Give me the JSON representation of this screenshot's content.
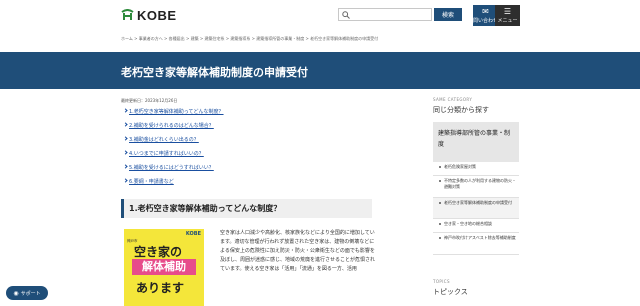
{
  "header": {
    "logo_text": "KOBE",
    "search_button": "検索",
    "contact_label": "問い合わせ",
    "menu_label": "メニュー"
  },
  "breadcrumb": "ホーム > 事業者の方へ > 各種届出 > 建築 > 建築住宅系 > 建築指導系 > 建築指導所管の事業・制度 > 老朽空き家等解体補助制度の申請受付",
  "page": {
    "title": "老朽空き家等解体補助制度の申請受付",
    "updated": "最終更新日：2023年12月26日"
  },
  "toc": [
    "1.老朽空き家等解体補助ってどんな制度？",
    "2.補助を受けられるのはどんな場合？",
    "3.補助金はどれくらい出るの？",
    "4.いつまでに申請すればいいの？",
    "5.補助を受けるにはどうすればいい？",
    "6.要綱・申請書など"
  ],
  "section": {
    "heading": "1.老朽空き家等解体補助ってどんな制度？",
    "body": "空き家は人口減少や高齢化、核家族化などにより全国的に増加しています。適切な管理が行われず放置された空き家は、建物の倒壊などによる保安上の危険性に加え防災・防火・公衆衛生などの面でも影響を及ぼし、周囲が迷惑に感じ、地域の荒廃を進行させることが危惧されています。使える空き家は「活用」「流通」を図る一方、活用"
  },
  "poster": {
    "badge": "KOBE",
    "subtitle": "神戸市",
    "line1": "空き家の",
    "line2": "解体補助",
    "line3": "あります"
  },
  "sidebar": {
    "same_category_label": "SAME CATEGORY",
    "same_category_title": "同じ分類から探す",
    "box_title": "建築指導部所管の事業・制度",
    "items": [
      "老朽危険家屋対策",
      "不特定多数の人が利用する建物の防火・避難対策",
      "老朽空き家等解体補助制度の申請受付",
      "空き家・空き地の総合相談",
      "神戸市吹付けアスベスト除去等補助制度"
    ],
    "topics_label": "TOPICS",
    "topics_title": "トピックス"
  },
  "support": {
    "label": "サポート"
  }
}
